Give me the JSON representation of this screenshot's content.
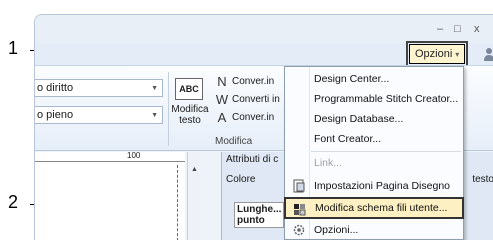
{
  "callouts": {
    "one": "1",
    "two": "2"
  },
  "window": {
    "minimize": "–",
    "maximize": "□",
    "close": "x"
  },
  "options_button": {
    "label": "Opzioni",
    "arrow": "▾"
  },
  "ribbon": {
    "combo1": "o diritto",
    "combo2": "o pieno",
    "abc_label": "ABC",
    "edit_text_label": "Modifica testo",
    "convert_rows": [
      {
        "glyph": "N",
        "label": "Conver.in"
      },
      {
        "glyph": "W",
        "label": "Converti in"
      },
      {
        "glyph": "A",
        "label": "Conver.in"
      }
    ],
    "group_label": "Modifica"
  },
  "workspace": {
    "ruler_label": "100",
    "attr_title": "Attributi di c",
    "colore_label": "Colore",
    "tab_right": "testo",
    "lunghezza_label": "Lunghe... punto"
  },
  "menu": {
    "items": [
      {
        "label": "Design Center...",
        "icon": "none",
        "disabled": false
      },
      {
        "label": "Programmable Stitch Creator...",
        "icon": "none",
        "disabled": false
      },
      {
        "label": "Design Database...",
        "icon": "none",
        "disabled": false
      },
      {
        "label": "Font Creator...",
        "icon": "none",
        "disabled": false
      },
      {
        "label": "Link...",
        "icon": "link-icon",
        "disabled": true
      },
      {
        "label": "Impostazioni Pagina Disegno",
        "icon": "page-setup-icon",
        "disabled": false
      },
      {
        "label": "Modifica schema fili utente...",
        "icon": "thread-chart-icon",
        "disabled": false,
        "highlighted": true
      },
      {
        "label": "Opzioni...",
        "icon": "gear-icon",
        "disabled": false
      }
    ]
  },
  "colors": {
    "highlight": "#fdf0c3",
    "ribbon_bg": "#e6eef8",
    "menu_border": "#8d9db2"
  }
}
